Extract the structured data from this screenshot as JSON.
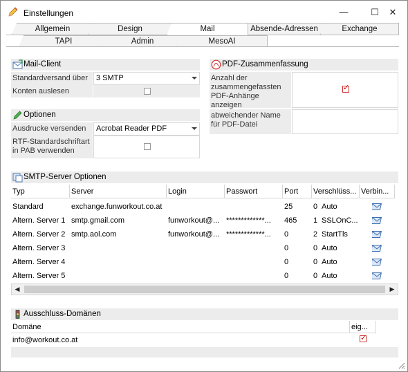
{
  "window": {
    "title": "Einstellungen",
    "minimize_glyph": "—",
    "maximize_glyph": "☐",
    "close_glyph": "✕"
  },
  "tabs": {
    "row1": [
      "Allgemein",
      "Design",
      "Mail",
      "Absende-Adressen",
      "Exchange"
    ],
    "row2": [
      "TAPI",
      "Admin",
      "MesoAI"
    ],
    "active": "Mail"
  },
  "mail_client": {
    "header": "Mail-Client",
    "standardversand_label": "Standardversand über",
    "standardversand_value": "3 SMTP",
    "konten_label": "Konten auslesen",
    "konten_checked": false
  },
  "optionen": {
    "header": "Optionen",
    "ausdrucke_label": "Ausdrucke versenden",
    "ausdrucke_value": "Acrobat Reader PDF",
    "rtf_label": "RTF-Standardschriftart in PAB verwenden",
    "rtf_checked": false
  },
  "pdf": {
    "header": "PDF-Zusammenfassung",
    "anzahl_label": "Anzahl der zusammengefassten PDF-Anhänge anzeigen",
    "anzahl_checked": true,
    "name_label": "abweichender Name für PDF-Datei",
    "name_value": ""
  },
  "smtp": {
    "header": "SMTP-Server Optionen",
    "columns": [
      "Typ",
      "Server",
      "Login",
      "Passwort",
      "Port",
      "Verschlüss...",
      "Verbin..."
    ],
    "rows": [
      {
        "typ": "Standard",
        "server": "exchange.funworkout.co.at",
        "login": "",
        "passwort": "",
        "port": "25",
        "encnum": "0",
        "enc": "Auto"
      },
      {
        "typ": "Altern. Server 1",
        "server": "smtp.gmail.com",
        "login": "funworkout@...",
        "passwort": "*************...",
        "port": "465",
        "encnum": "1",
        "enc": "SSLOnC..."
      },
      {
        "typ": "Altern. Server 2",
        "server": "smtp.aol.com",
        "login": "funworkout@...",
        "passwort": "*************...",
        "port": "0",
        "encnum": "2",
        "enc": "StartTls"
      },
      {
        "typ": "Altern. Server 3",
        "server": "",
        "login": "",
        "passwort": "",
        "port": "0",
        "encnum": "0",
        "enc": "Auto"
      },
      {
        "typ": "Altern. Server 4",
        "server": "",
        "login": "",
        "passwort": "",
        "port": "0",
        "encnum": "0",
        "enc": "Auto"
      },
      {
        "typ": "Altern. Server 5",
        "server": "",
        "login": "",
        "passwort": "",
        "port": "0",
        "encnum": "0",
        "enc": "Auto"
      }
    ]
  },
  "ausschluss": {
    "header": "Ausschluss-Domänen",
    "col_domain": "Domäne",
    "col_eig": "eig...",
    "rows": [
      {
        "domain": "info@workout.co.at",
        "checked": true
      }
    ]
  },
  "colors": {
    "section_bg": "#ececec",
    "check_red": "#cc0000"
  }
}
